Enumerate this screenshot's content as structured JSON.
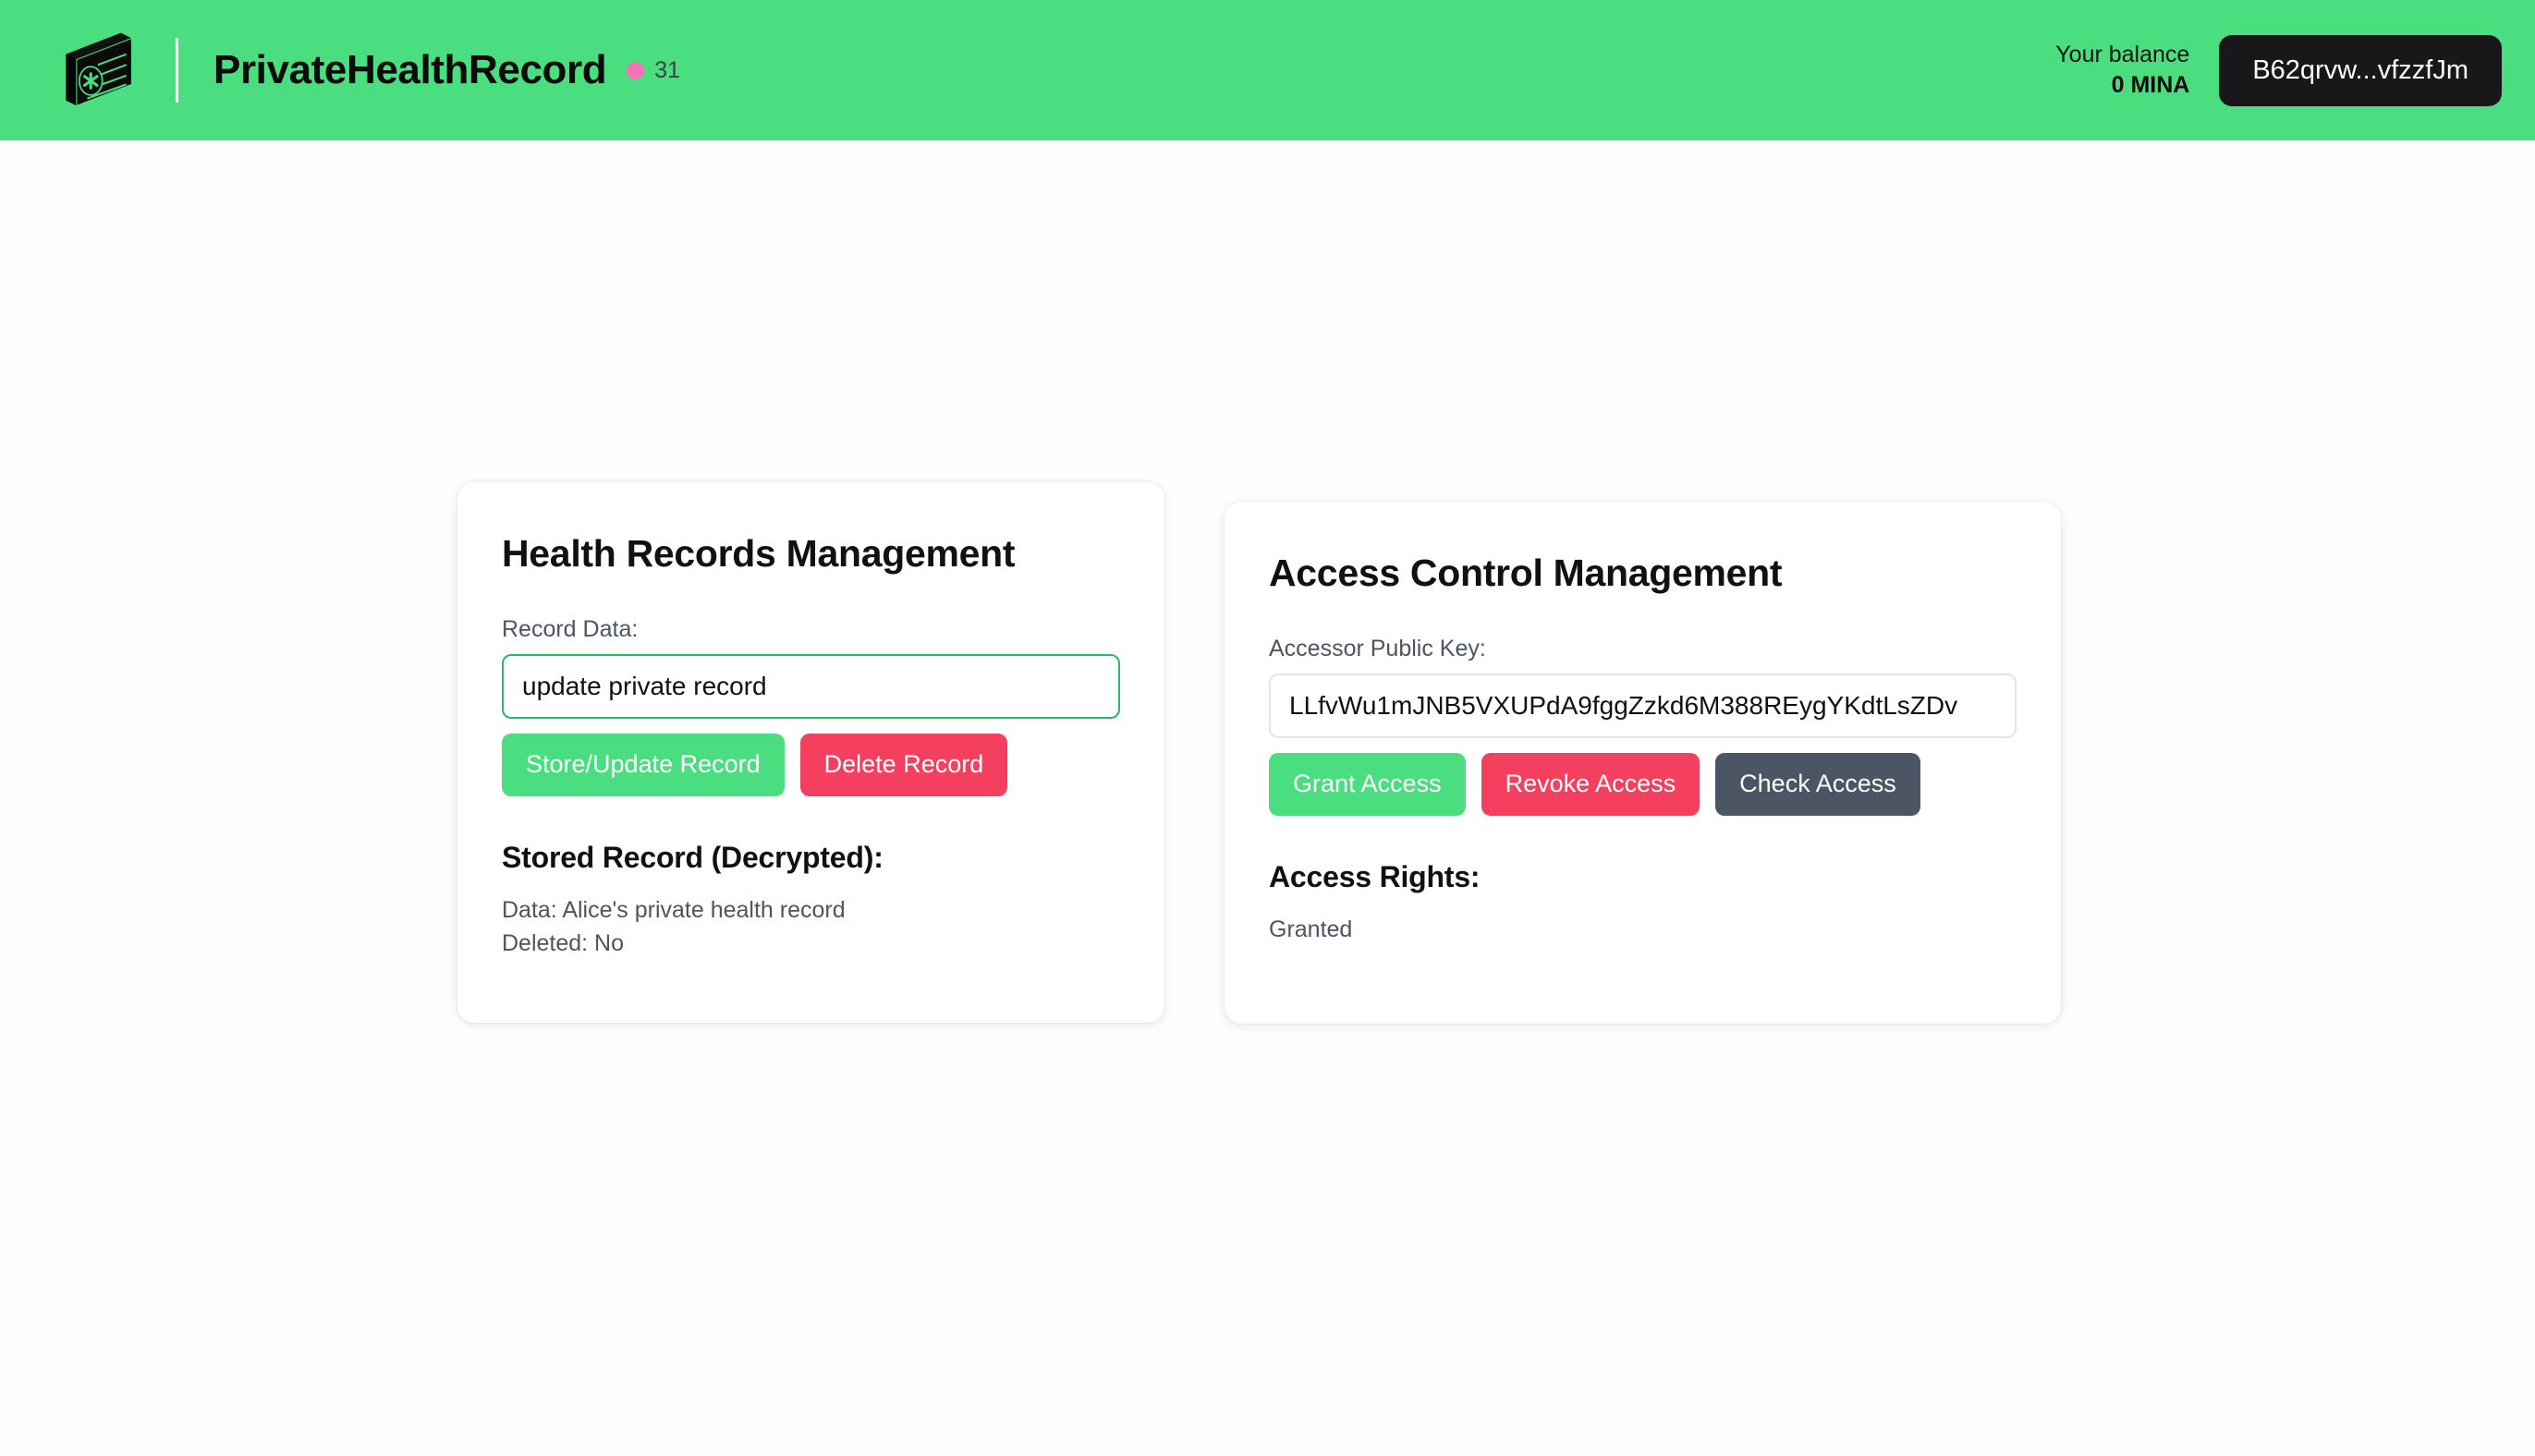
{
  "header": {
    "logo_icon": "isometric-health-card-icon",
    "app_title": "PrivateHealthRecord",
    "block_dot_icon": "status-dot-icon",
    "block_count": "31",
    "balance_label": "Your balance",
    "balance_value": "0 MINA",
    "account_address": "B62qrvw...vfzzfJm"
  },
  "records_card": {
    "title": "Health Records Management",
    "record_data_label": "Record Data:",
    "record_data_value": "update private record",
    "record_data_placeholder": "Enter record data",
    "store_button": "Store/Update Record",
    "delete_button": "Delete Record",
    "stored_record_heading": "Stored Record (Decrypted):",
    "stored_data_line": "Data: Alice's private health record",
    "stored_deleted_line": "Deleted: No"
  },
  "access_card": {
    "title": "Access Control Management",
    "accessor_key_label": "Accessor Public Key:",
    "accessor_key_value": "LLfvWu1mJNB5VXUPdA9fggZzkd6M388REygYKdtLsZDv",
    "accessor_key_placeholder": "Enter accessor public key",
    "grant_button": "Grant Access",
    "revoke_button": "Revoke Access",
    "check_button": "Check Access",
    "access_rights_heading": "Access Rights:",
    "access_rights_value": "Granted"
  },
  "colors": {
    "header_green": "#4ade80",
    "button_green": "#4ade80",
    "button_red": "#f43f5e",
    "button_slate": "#4b5563",
    "accent_pink": "#f472b6",
    "account_pill": "#18181b",
    "focus_border": "#2eb866",
    "page_background": "#fdfdfd"
  }
}
